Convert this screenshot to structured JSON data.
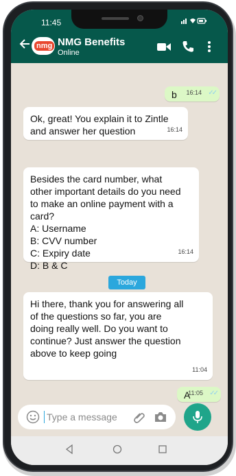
{
  "status_bar": {
    "time": "11:45",
    "icons": "signal wifi battery"
  },
  "header": {
    "avatar_text": "nmg",
    "contact_name": "NMG Benefits",
    "contact_status": "Online",
    "icons": [
      "back-arrow-icon",
      "video-camera-icon",
      "phone-icon",
      "more-vertical-icon"
    ]
  },
  "messages": [
    {
      "direction": "outgoing",
      "text": "b",
      "time": "16:14",
      "ticks": "✓✓"
    },
    {
      "direction": "incoming",
      "text": "Ok, great! You explain it to Zintle\nand answer her question",
      "time": "16:14"
    },
    {
      "direction": "incoming",
      "text": "Besides the card number, what\nother important details do you need\nto make an online payment with a\ncard?\nA: Username\nB: CVV number\nC: Expiry date\nD: B & C",
      "time": "16:14"
    },
    {
      "direction": "incoming",
      "text": "Hi there, thank you for answering all\nof the questions so far, you are\ndoing really well. Do you want to\ncontinue? Just answer the question\nabove to keep going",
      "time": "11:04"
    },
    {
      "direction": "outgoing",
      "text": "A",
      "time": "11:05",
      "ticks": "✓✓"
    }
  ],
  "date_divider": "Today",
  "composer": {
    "placeholder": "Type a message",
    "value": ""
  },
  "colors": {
    "header": "#06584b",
    "chat_bg": "#e8e1d8",
    "outgoing_bubble": "#dcf8c6",
    "today_pill": "#2ba7dd",
    "mic_button": "#1fa58a"
  }
}
